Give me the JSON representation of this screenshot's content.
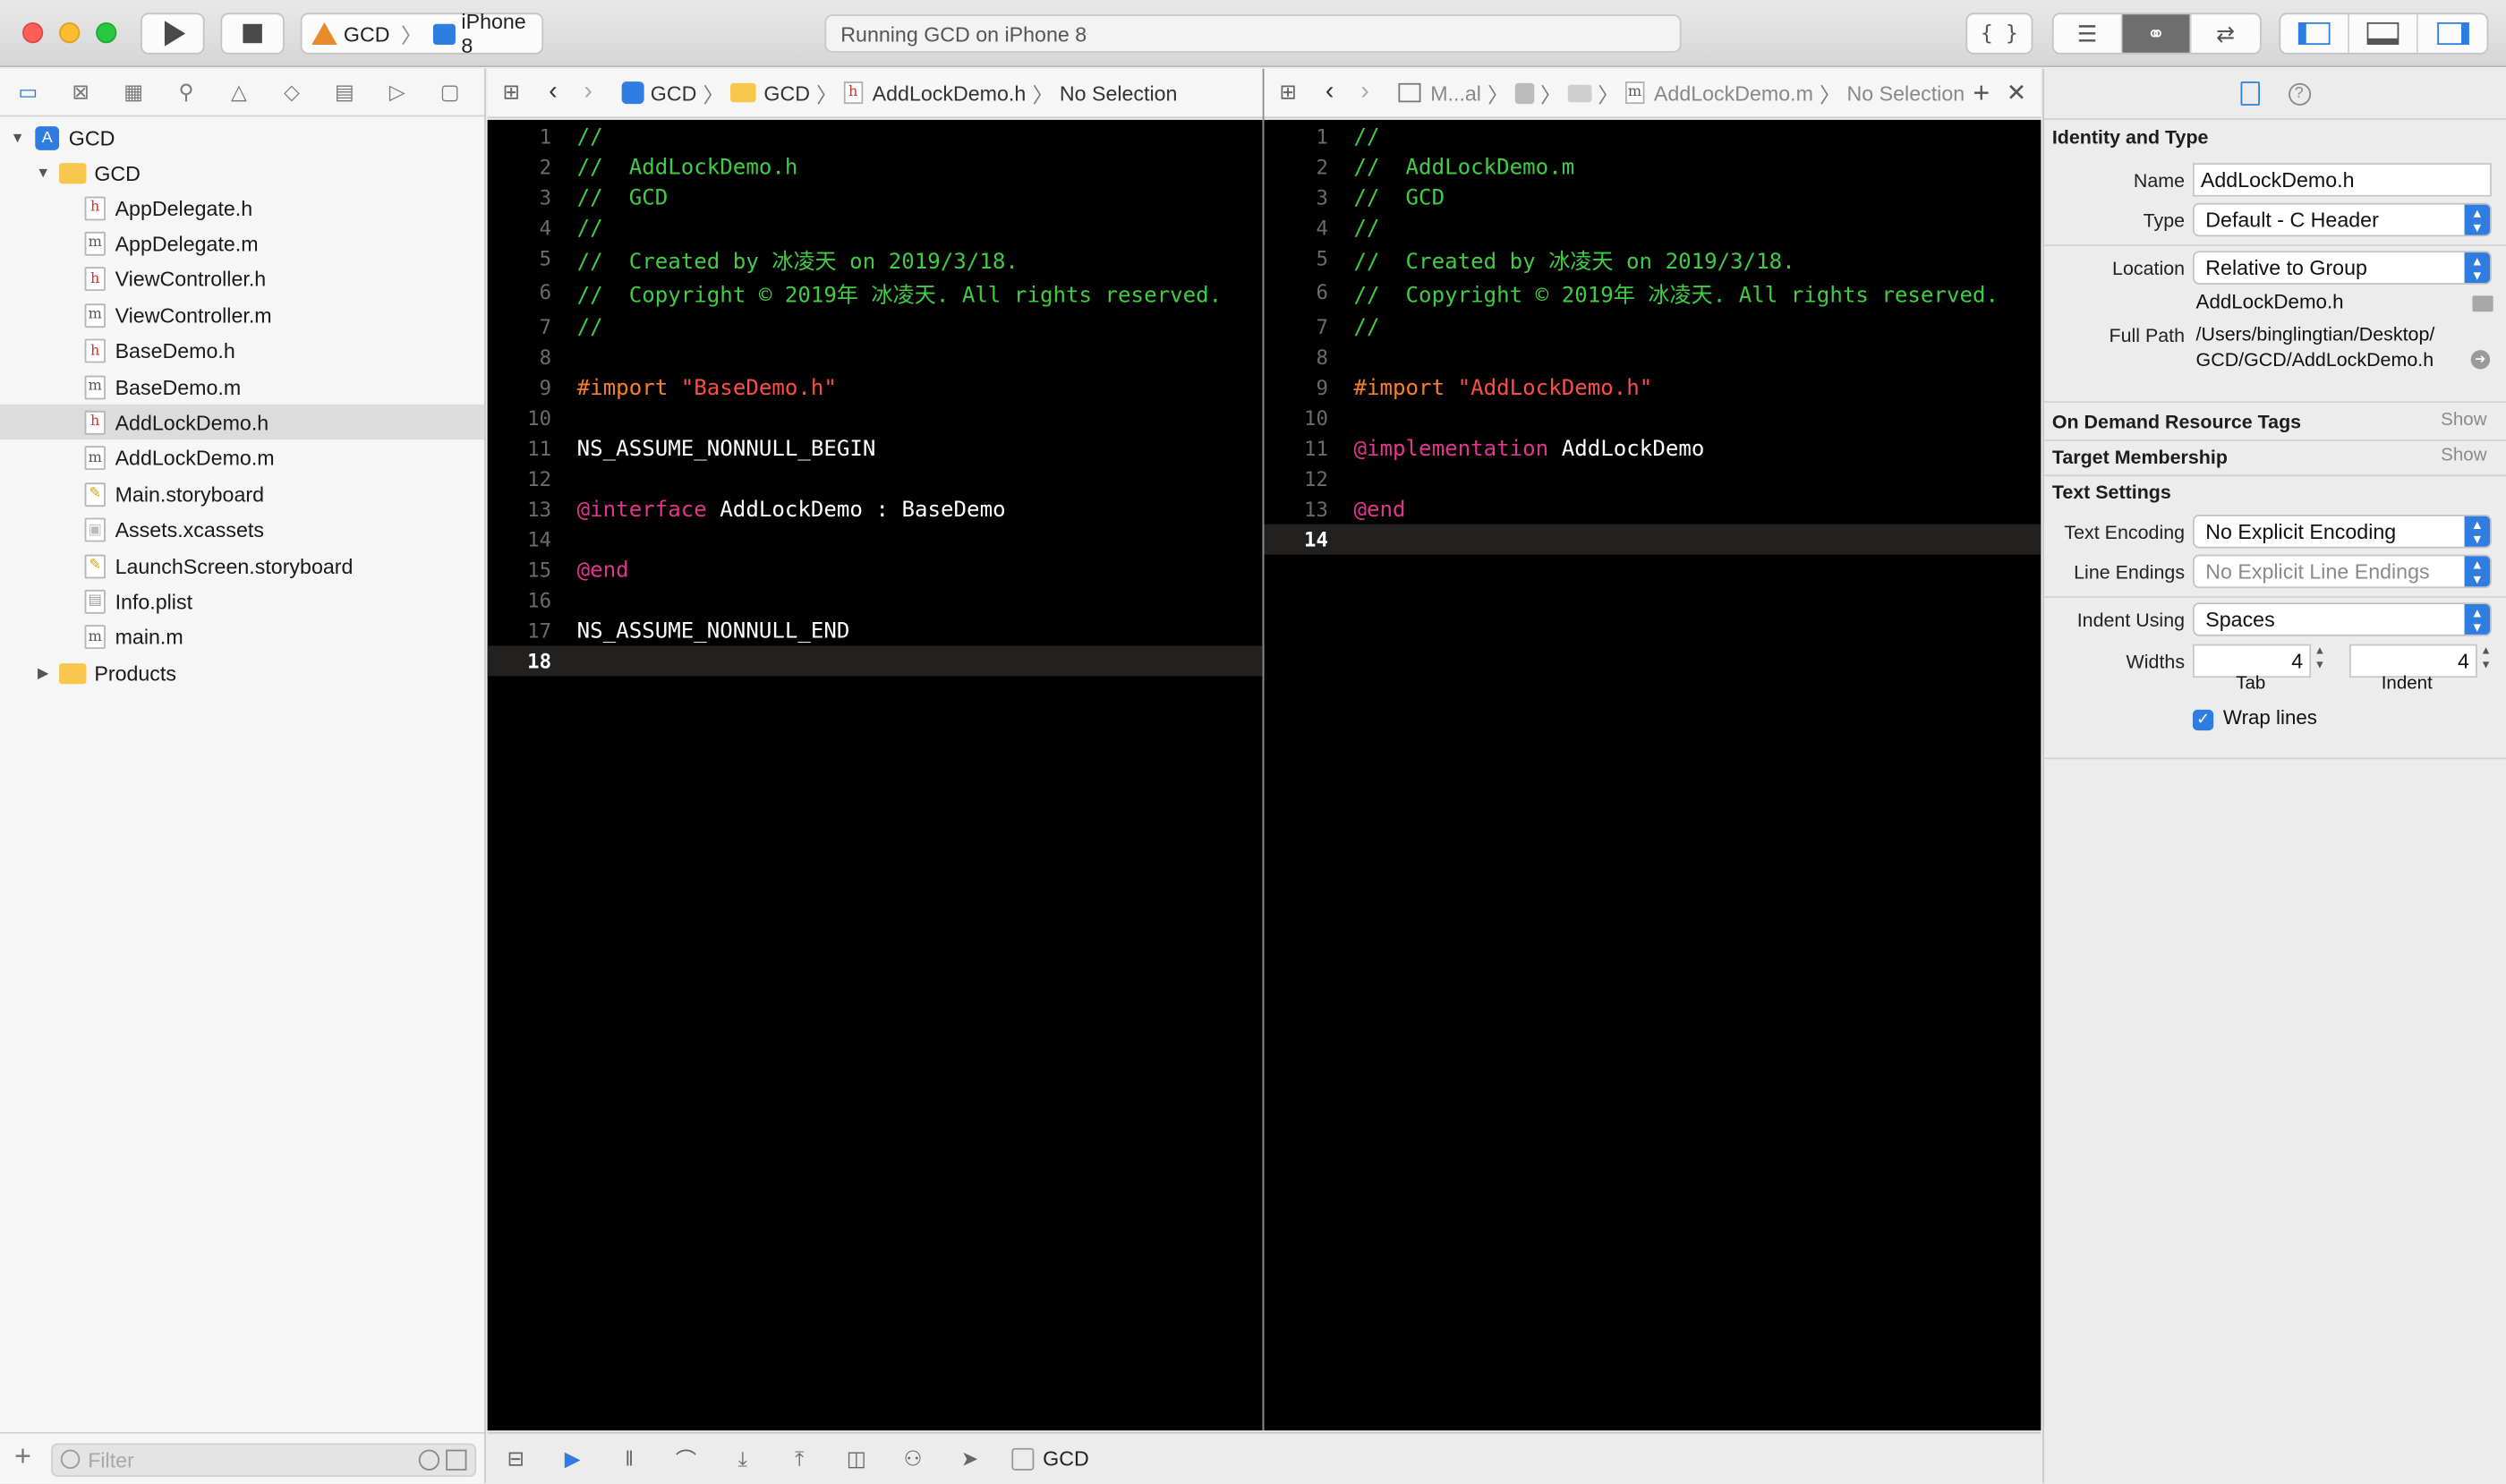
{
  "toolbar": {
    "scheme": "GCD",
    "device": "iPhone 8",
    "status": "Running GCD on iPhone 8",
    "play_icon": "play-icon",
    "stop_icon": "stop-icon"
  },
  "navigator": {
    "filter_placeholder": "Filter",
    "project": "GCD",
    "group": "GCD",
    "files": [
      {
        "name": "AppDelegate.h",
        "kind": "h"
      },
      {
        "name": "AppDelegate.m",
        "kind": "m"
      },
      {
        "name": "ViewController.h",
        "kind": "h"
      },
      {
        "name": "ViewController.m",
        "kind": "m"
      },
      {
        "name": "BaseDemo.h",
        "kind": "h"
      },
      {
        "name": "BaseDemo.m",
        "kind": "m"
      },
      {
        "name": "AddLockDemo.h",
        "kind": "h"
      },
      {
        "name": "AddLockDemo.m",
        "kind": "m"
      },
      {
        "name": "Main.storyboard",
        "kind": "sb"
      },
      {
        "name": "Assets.xcassets",
        "kind": "as"
      },
      {
        "name": "LaunchScreen.storyboard",
        "kind": "sb"
      },
      {
        "name": "Info.plist",
        "kind": "pl"
      },
      {
        "name": "main.m",
        "kind": "m"
      }
    ],
    "products": "Products"
  },
  "left_editor": {
    "jump": {
      "p1": "GCD",
      "p2": "GCD",
      "p3": "AddLockDemo.h",
      "p4": "No Selection"
    },
    "lines": [
      [
        {
          "t": "//",
          "c": "com"
        }
      ],
      [
        {
          "t": "//  AddLockDemo.h",
          "c": "com"
        }
      ],
      [
        {
          "t": "//  GCD",
          "c": "com"
        }
      ],
      [
        {
          "t": "//",
          "c": "com"
        }
      ],
      [
        {
          "t": "//  Created by 冰凌天 on 2019/3/18.",
          "c": "com"
        }
      ],
      [
        {
          "t": "//  Copyright © 2019年 冰凌天. All rights reserved.",
          "c": "com"
        }
      ],
      [
        {
          "t": "//",
          "c": "com"
        }
      ],
      [],
      [
        {
          "t": "#import ",
          "c": "pp"
        },
        {
          "t": "\"BaseDemo.h\"",
          "c": "str"
        }
      ],
      [],
      [
        {
          "t": "NS_ASSUME_NONNULL_BEGIN",
          "c": "pl"
        }
      ],
      [],
      [
        {
          "t": "@interface",
          "c": "kw"
        },
        {
          "t": " AddLockDemo : BaseDemo",
          "c": "pl"
        }
      ],
      [],
      [
        {
          "t": "@end",
          "c": "kw"
        }
      ],
      [],
      [
        {
          "t": "NS_ASSUME_NONNULL_END",
          "c": "pl"
        }
      ],
      []
    ],
    "current_line": 18
  },
  "right_editor": {
    "jump": {
      "p1": "M...al",
      "p2": "AddLockDemo.m",
      "p3": "No Selection"
    },
    "lines": [
      [
        {
          "t": "//",
          "c": "com"
        }
      ],
      [
        {
          "t": "//  AddLockDemo.m",
          "c": "com"
        }
      ],
      [
        {
          "t": "//  GCD",
          "c": "com"
        }
      ],
      [
        {
          "t": "//",
          "c": "com"
        }
      ],
      [
        {
          "t": "//  Created by 冰凌天 on 2019/3/18.",
          "c": "com"
        }
      ],
      [
        {
          "t": "//  Copyright © 2019年 冰凌天. All rights reserved.",
          "c": "com"
        }
      ],
      [
        {
          "t": "//",
          "c": "com"
        }
      ],
      [],
      [
        {
          "t": "#import ",
          "c": "pp"
        },
        {
          "t": "\"AddLockDemo.h\"",
          "c": "str"
        }
      ],
      [],
      [
        {
          "t": "@implementation",
          "c": "kw"
        },
        {
          "t": " AddLockDemo",
          "c": "pl"
        }
      ],
      [],
      [
        {
          "t": "@end",
          "c": "kw"
        }
      ],
      []
    ],
    "current_line": 14
  },
  "debug": {
    "target": "GCD"
  },
  "inspector": {
    "identity_title": "Identity and Type",
    "name_label": "Name",
    "name_value": "AddLockDemo.h",
    "type_label": "Type",
    "type_value": "Default - C Header",
    "location_label": "Location",
    "location_value": "Relative to Group",
    "location_file": "AddLockDemo.h",
    "fullpath_label": "Full Path",
    "fullpath_1": "/Users/binglingtian/Desktop/",
    "fullpath_2": "GCD/GCD/AddLockDemo.h",
    "odr_title": "On Demand Resource Tags",
    "target_title": "Target Membership",
    "show": "Show",
    "text_title": "Text Settings",
    "encoding_label": "Text Encoding",
    "encoding_value": "No Explicit Encoding",
    "endings_label": "Line Endings",
    "endings_value": "No Explicit Line Endings",
    "indent_label": "Indent Using",
    "indent_value": "Spaces",
    "widths_label": "Widths",
    "tab_value": "4",
    "indent_width_value": "4",
    "tab_caption": "Tab",
    "indent_caption": "Indent",
    "wrap_label": "Wrap lines"
  }
}
